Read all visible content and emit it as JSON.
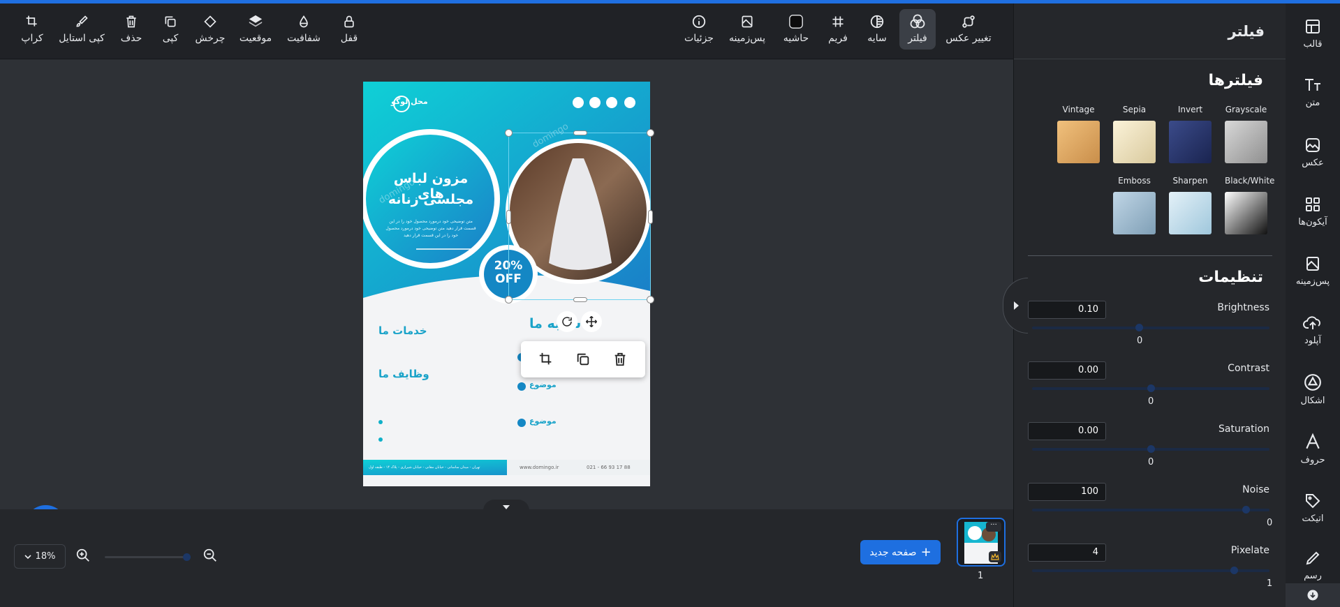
{
  "toolbar": {
    "left": [
      {
        "key": "crop",
        "label": "کراپ",
        "icon": "crop-icon"
      },
      {
        "key": "copy_style",
        "label": "کپی استایل",
        "icon": "brush-icon"
      },
      {
        "key": "delete",
        "label": "حذف",
        "icon": "trash-icon"
      },
      {
        "key": "copy",
        "label": "کپی",
        "icon": "copy-icon"
      },
      {
        "key": "rotate",
        "label": "چرخش",
        "icon": "rotate-tag-icon"
      },
      {
        "key": "position",
        "label": "موقعیت",
        "icon": "layers-icon"
      },
      {
        "key": "opacity",
        "label": "شفافیت",
        "icon": "drop-icon"
      },
      {
        "key": "lock",
        "label": "قفل",
        "icon": "lock-icon"
      }
    ],
    "right": [
      {
        "key": "details",
        "label": "جزئیات",
        "icon": "info-icon"
      },
      {
        "key": "background",
        "label": "پس‌زمینه",
        "icon": "background-icon"
      },
      {
        "key": "border",
        "label": "حاشیه",
        "icon": "border-icon"
      },
      {
        "key": "frame",
        "label": "فریم",
        "icon": "frame-icon"
      },
      {
        "key": "shadow",
        "label": "سایه",
        "icon": "shadow-icon"
      },
      {
        "key": "filter",
        "label": "فیلتر",
        "icon": "filter-icon",
        "active": true
      },
      {
        "key": "change_photo",
        "label": "تغییر عکس",
        "icon": "swap-photo-icon"
      }
    ]
  },
  "document": {
    "logo_text": "محل لوگو",
    "headline": "مزون لباس های",
    "headline2": "مجلسی زنانه",
    "body_small": "متن توضیحی خود درمورد محصول خود را در این قسمت قرار دهید متن توضیحی خود درمورد محصول خود را در این قسمت قرار دهید",
    "badge_percent": "20%",
    "badge_off": "OFF",
    "services_title": "خدمات ما",
    "duties_title": "وظایف ما",
    "branch_title": "شعبه ما",
    "topic": "موضوع",
    "website": "www.domingo.ir",
    "phone": "021 - 66 93 17 88",
    "address": "تهران - میدان ساسانی - خیابان مقانی - خیابان شیرازی - پلاک ۱۴ - طبقه اول",
    "watermark": "domingo"
  },
  "bottom": {
    "zoom": "18%",
    "new_page": "صفحه جدید",
    "page_number": "1"
  },
  "panel": {
    "header": "فیلتر",
    "filters_title": "فیلترها",
    "filters": [
      {
        "name": "Grayscale",
        "color": "#b9b9b9"
      },
      {
        "name": "Invert",
        "color": "#2c3c7a"
      },
      {
        "name": "Sepia",
        "color": "#f1e6c0"
      },
      {
        "name": "Vintage",
        "color": "#e9b36e"
      },
      {
        "name": "Black/White",
        "color": "#ffffff"
      },
      {
        "name": "Sharpen",
        "color": "#cfe3ef"
      },
      {
        "name": "Emboss",
        "color": "#a9c4d8"
      }
    ],
    "settings_title": "تنظیمات",
    "settings": [
      {
        "name": "Brightness",
        "value": "0.10",
        "min": "0",
        "level": 0.45
      },
      {
        "name": "Contrast",
        "value": "0.00",
        "min": "0",
        "level": 0.5
      },
      {
        "name": "Saturation",
        "value": "0.00",
        "min": "0",
        "level": 0.5
      },
      {
        "name": "Noise",
        "value": "100",
        "min": "0",
        "level": 0.9
      },
      {
        "name": "Pixelate",
        "value": "4",
        "min": "1",
        "level": 0.85
      }
    ]
  },
  "nav": [
    {
      "label": "قالب",
      "icon": "template-icon"
    },
    {
      "label": "متن",
      "icon": "text-icon"
    },
    {
      "label": "عکس",
      "icon": "image-icon"
    },
    {
      "label": "آیکون‌ها",
      "icon": "icons-grid-icon"
    },
    {
      "label": "پس‌زمینه",
      "icon": "background-panel-icon"
    },
    {
      "label": "آپلود",
      "icon": "upload-icon"
    },
    {
      "label": "اشکال",
      "icon": "shapes-icon"
    },
    {
      "label": "حروف",
      "icon": "font-icon"
    },
    {
      "label": "اتیکت",
      "icon": "tag-icon"
    },
    {
      "label": "رسم",
      "icon": "pencil-icon"
    }
  ],
  "colors": {
    "accent": "#1e6fe0",
    "teal": "#17a9c4",
    "toolbar_bg": "#202226",
    "panel_bg": "#25272b"
  }
}
